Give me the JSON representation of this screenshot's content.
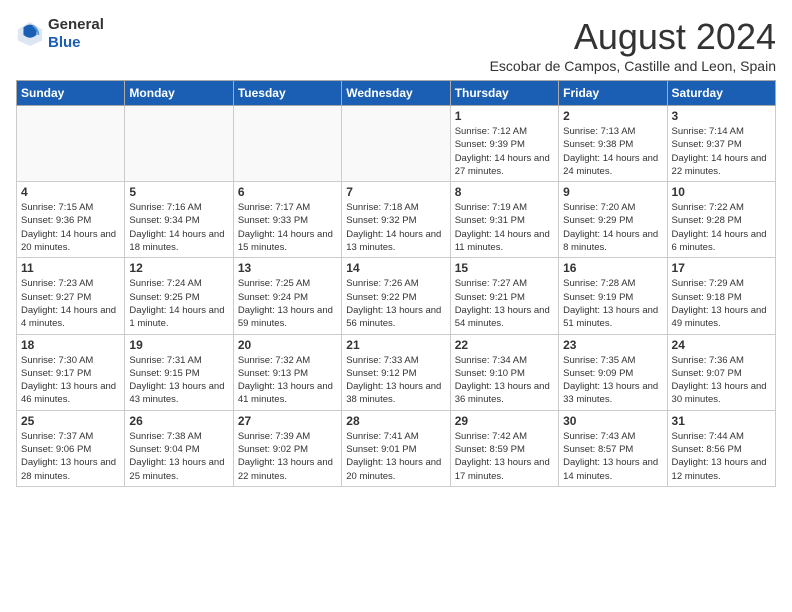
{
  "logo": {
    "text1": "General",
    "text2": "Blue"
  },
  "title": "August 2024",
  "subtitle": "Escobar de Campos, Castille and Leon, Spain",
  "headers": [
    "Sunday",
    "Monday",
    "Tuesday",
    "Wednesday",
    "Thursday",
    "Friday",
    "Saturday"
  ],
  "weeks": [
    [
      {
        "day": "",
        "info": ""
      },
      {
        "day": "",
        "info": ""
      },
      {
        "day": "",
        "info": ""
      },
      {
        "day": "",
        "info": ""
      },
      {
        "day": "1",
        "info": "Sunrise: 7:12 AM\nSunset: 9:39 PM\nDaylight: 14 hours and 27 minutes."
      },
      {
        "day": "2",
        "info": "Sunrise: 7:13 AM\nSunset: 9:38 PM\nDaylight: 14 hours and 24 minutes."
      },
      {
        "day": "3",
        "info": "Sunrise: 7:14 AM\nSunset: 9:37 PM\nDaylight: 14 hours and 22 minutes."
      }
    ],
    [
      {
        "day": "4",
        "info": "Sunrise: 7:15 AM\nSunset: 9:36 PM\nDaylight: 14 hours and 20 minutes."
      },
      {
        "day": "5",
        "info": "Sunrise: 7:16 AM\nSunset: 9:34 PM\nDaylight: 14 hours and 18 minutes."
      },
      {
        "day": "6",
        "info": "Sunrise: 7:17 AM\nSunset: 9:33 PM\nDaylight: 14 hours and 15 minutes."
      },
      {
        "day": "7",
        "info": "Sunrise: 7:18 AM\nSunset: 9:32 PM\nDaylight: 14 hours and 13 minutes."
      },
      {
        "day": "8",
        "info": "Sunrise: 7:19 AM\nSunset: 9:31 PM\nDaylight: 14 hours and 11 minutes."
      },
      {
        "day": "9",
        "info": "Sunrise: 7:20 AM\nSunset: 9:29 PM\nDaylight: 14 hours and 8 minutes."
      },
      {
        "day": "10",
        "info": "Sunrise: 7:22 AM\nSunset: 9:28 PM\nDaylight: 14 hours and 6 minutes."
      }
    ],
    [
      {
        "day": "11",
        "info": "Sunrise: 7:23 AM\nSunset: 9:27 PM\nDaylight: 14 hours and 4 minutes."
      },
      {
        "day": "12",
        "info": "Sunrise: 7:24 AM\nSunset: 9:25 PM\nDaylight: 14 hours and 1 minute."
      },
      {
        "day": "13",
        "info": "Sunrise: 7:25 AM\nSunset: 9:24 PM\nDaylight: 13 hours and 59 minutes."
      },
      {
        "day": "14",
        "info": "Sunrise: 7:26 AM\nSunset: 9:22 PM\nDaylight: 13 hours and 56 minutes."
      },
      {
        "day": "15",
        "info": "Sunrise: 7:27 AM\nSunset: 9:21 PM\nDaylight: 13 hours and 54 minutes."
      },
      {
        "day": "16",
        "info": "Sunrise: 7:28 AM\nSunset: 9:19 PM\nDaylight: 13 hours and 51 minutes."
      },
      {
        "day": "17",
        "info": "Sunrise: 7:29 AM\nSunset: 9:18 PM\nDaylight: 13 hours and 49 minutes."
      }
    ],
    [
      {
        "day": "18",
        "info": "Sunrise: 7:30 AM\nSunset: 9:17 PM\nDaylight: 13 hours and 46 minutes."
      },
      {
        "day": "19",
        "info": "Sunrise: 7:31 AM\nSunset: 9:15 PM\nDaylight: 13 hours and 43 minutes."
      },
      {
        "day": "20",
        "info": "Sunrise: 7:32 AM\nSunset: 9:13 PM\nDaylight: 13 hours and 41 minutes."
      },
      {
        "day": "21",
        "info": "Sunrise: 7:33 AM\nSunset: 9:12 PM\nDaylight: 13 hours and 38 minutes."
      },
      {
        "day": "22",
        "info": "Sunrise: 7:34 AM\nSunset: 9:10 PM\nDaylight: 13 hours and 36 minutes."
      },
      {
        "day": "23",
        "info": "Sunrise: 7:35 AM\nSunset: 9:09 PM\nDaylight: 13 hours and 33 minutes."
      },
      {
        "day": "24",
        "info": "Sunrise: 7:36 AM\nSunset: 9:07 PM\nDaylight: 13 hours and 30 minutes."
      }
    ],
    [
      {
        "day": "25",
        "info": "Sunrise: 7:37 AM\nSunset: 9:06 PM\nDaylight: 13 hours and 28 minutes."
      },
      {
        "day": "26",
        "info": "Sunrise: 7:38 AM\nSunset: 9:04 PM\nDaylight: 13 hours and 25 minutes."
      },
      {
        "day": "27",
        "info": "Sunrise: 7:39 AM\nSunset: 9:02 PM\nDaylight: 13 hours and 22 minutes."
      },
      {
        "day": "28",
        "info": "Sunrise: 7:41 AM\nSunset: 9:01 PM\nDaylight: 13 hours and 20 minutes."
      },
      {
        "day": "29",
        "info": "Sunrise: 7:42 AM\nSunset: 8:59 PM\nDaylight: 13 hours and 17 minutes."
      },
      {
        "day": "30",
        "info": "Sunrise: 7:43 AM\nSunset: 8:57 PM\nDaylight: 13 hours and 14 minutes."
      },
      {
        "day": "31",
        "info": "Sunrise: 7:44 AM\nSunset: 8:56 PM\nDaylight: 13 hours and 12 minutes."
      }
    ]
  ]
}
